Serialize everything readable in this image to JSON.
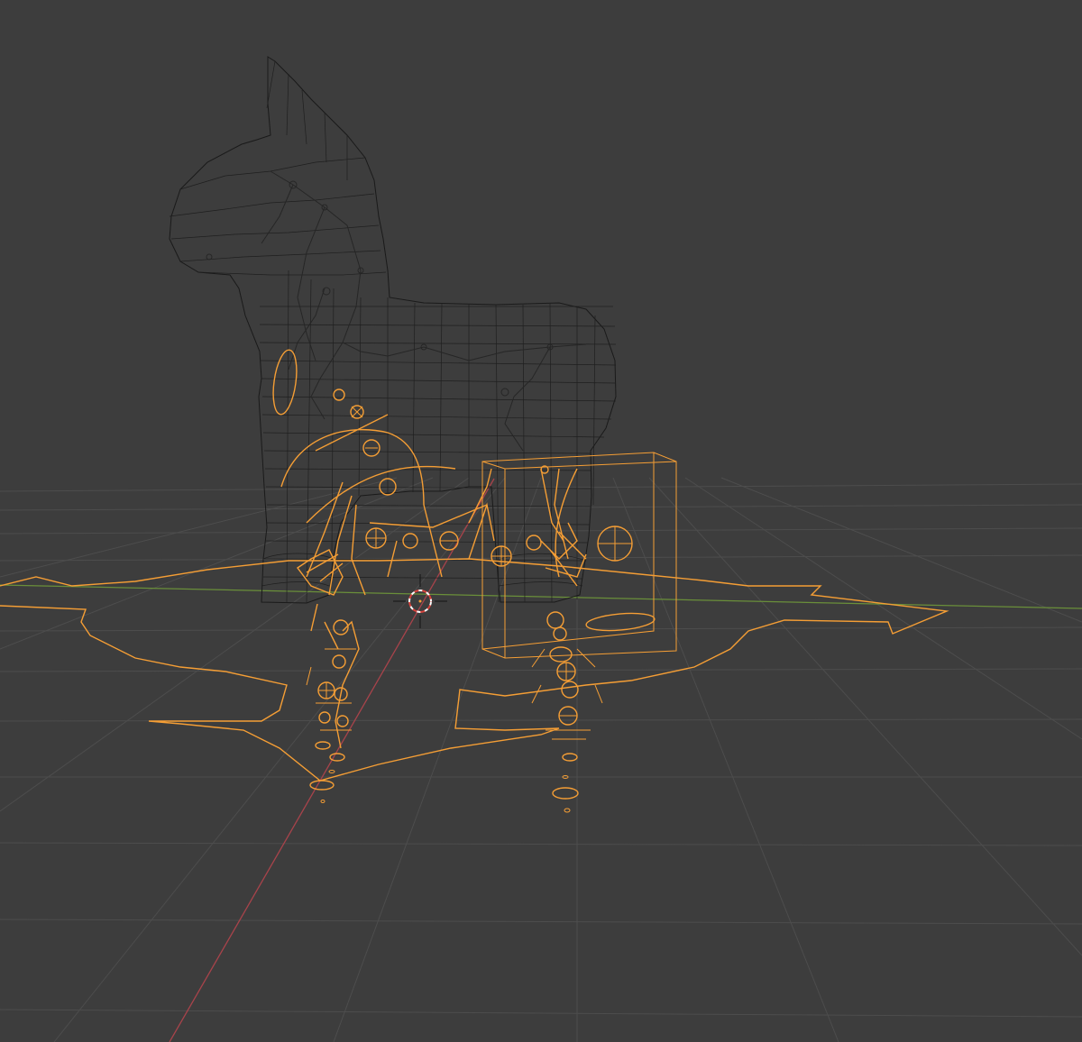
{
  "viewport": {
    "background": "#3d3d3d",
    "grid_color": "#4d4d4d",
    "x_axis_color": "#a8434b",
    "y_axis_color": "#6a8f3a",
    "wire_color": "#1a1a1a",
    "selected_color": "#f59e35",
    "cursor_colors": [
      "#ffffff",
      "#d8423c"
    ],
    "objects": [
      {
        "name": "llama-mesh",
        "state": "unselected",
        "display": "wireframe"
      },
      {
        "name": "rig-armature",
        "state": "selected"
      },
      {
        "name": "root-control",
        "state": "selected"
      },
      {
        "name": "box-control",
        "state": "selected"
      }
    ],
    "icons": {
      "cursor": "3d-cursor-icon"
    }
  }
}
